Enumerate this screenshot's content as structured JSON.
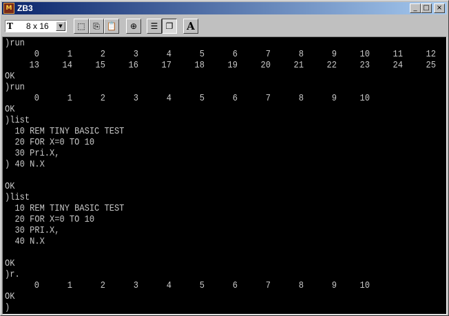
{
  "window": {
    "title": "ZB3",
    "icon_glyph": "M",
    "controls": {
      "minimize": "_",
      "maximize": "□",
      "close": "×"
    }
  },
  "toolbar": {
    "font_select_icon": "T",
    "font_select_value": "8 x 16",
    "buttons": [
      {
        "name": "select-icon",
        "glyph": "⬚"
      },
      {
        "name": "copy-icon",
        "glyph": "⎘"
      },
      {
        "name": "paste-icon",
        "glyph": "📋"
      },
      {
        "name": "fullscreen-icon",
        "glyph": "⊕"
      },
      {
        "name": "properties-icon",
        "glyph": "☰"
      },
      {
        "name": "background-icon",
        "glyph": "❐"
      },
      {
        "name": "font-icon",
        "glyph": "A"
      }
    ]
  },
  "terminal": {
    "lines": [
      ")run",
      "",
      "",
      "OK",
      ")run",
      "",
      "OK",
      ")list",
      "  10 REM TINY BASIC TEST",
      "  20 FOR X=0 TO 10",
      "  30 Pri.X,",
      ") 40 N.X",
      "",
      "OK",
      ")list",
      "  10 REM TINY BASIC TEST",
      "  20 FOR X=0 TO 10",
      "  30 PRI.X,",
      "  40 N.X",
      "",
      "OK",
      ")r.",
      "",
      "OK",
      ")"
    ],
    "number_rows": [
      {
        "line": 1,
        "values": [
          "0",
          "1",
          "2",
          "3",
          "4",
          "5",
          "6",
          "7",
          "8",
          "9",
          "10",
          "11",
          "12"
        ]
      },
      {
        "line": 2,
        "values": [
          "13",
          "14",
          "15",
          "16",
          "17",
          "18",
          "19",
          "20",
          "21",
          "22",
          "23",
          "24",
          "25"
        ]
      },
      {
        "line": 5,
        "values": [
          "0",
          "1",
          "2",
          "3",
          "4",
          "5",
          "6",
          "7",
          "8",
          "9",
          "10"
        ]
      },
      {
        "line": 22,
        "values": [
          "0",
          "1",
          "2",
          "3",
          "4",
          "5",
          "6",
          "7",
          "8",
          "9",
          "10"
        ]
      }
    ]
  }
}
